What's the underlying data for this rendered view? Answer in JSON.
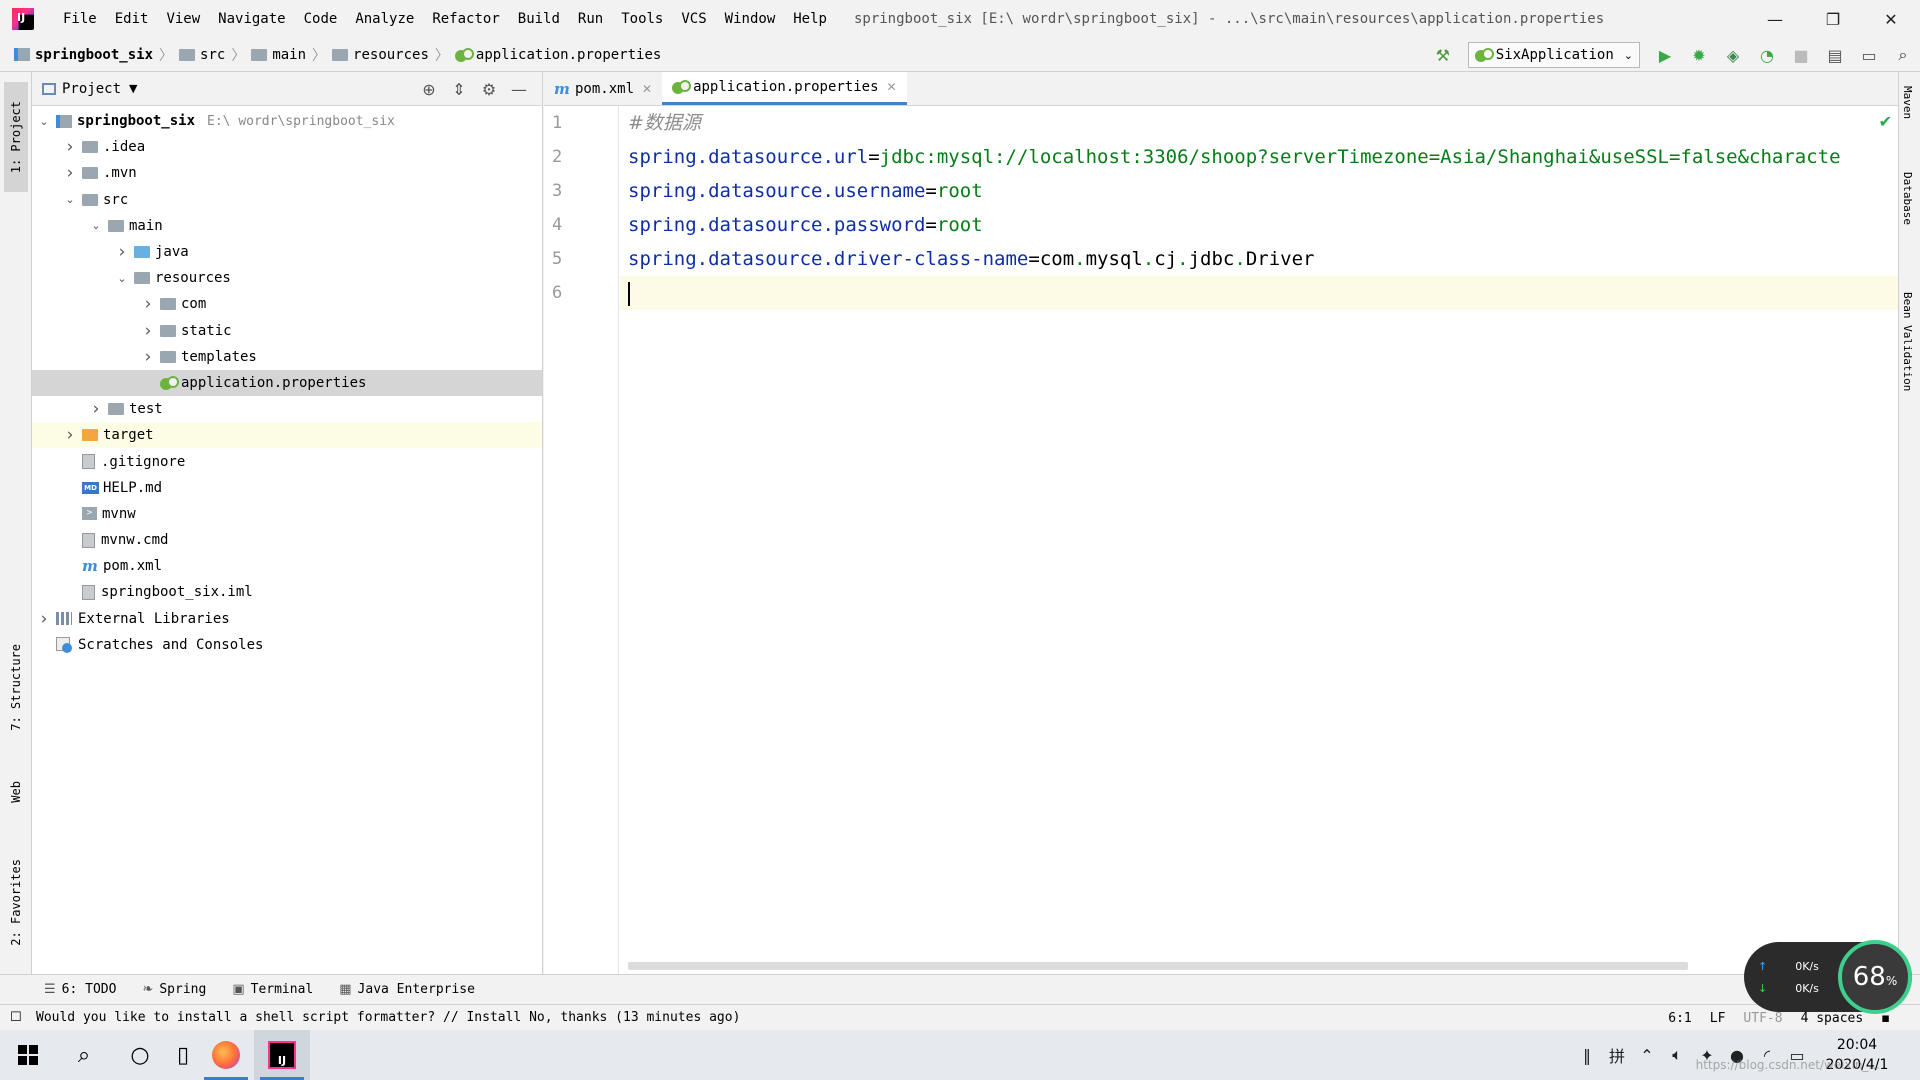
{
  "app": {
    "logo_letters": "IJ",
    "window_title": "springboot_six [E:\\ wordr\\springboot_six] - ...\\src\\main\\resources\\application.properties"
  },
  "menu": [
    "File",
    "Edit",
    "View",
    "Navigate",
    "Code",
    "Analyze",
    "Refactor",
    "Build",
    "Run",
    "Tools",
    "VCS",
    "Window",
    "Help"
  ],
  "window_controls": {
    "minimize": "—",
    "restore": "❐",
    "close": "✕"
  },
  "breadcrumb": [
    "springboot_six",
    "src",
    "main",
    "resources",
    "application.properties"
  ],
  "toolbar": {
    "run_config": "SixApplication",
    "icons": [
      "hammer-icon",
      "run-icon",
      "debug-icon",
      "coverage-icon",
      "profile-icon",
      "stop-icon",
      "project-structure-icon",
      "terminal-window-icon",
      "search-icon"
    ]
  },
  "left_strip": {
    "project": "1: Project",
    "structure": "7: Structure",
    "web": "Web",
    "favorites": "2: Favorites"
  },
  "right_strip": {
    "maven": "Maven",
    "database": "Database",
    "bean_validation": "Bean Validation"
  },
  "project_panel": {
    "title": "Project",
    "tree": [
      {
        "label": "springboot_six",
        "hint": "E:\\ wordr\\springboot_six",
        "indent": 0,
        "arrow": "down",
        "icon": "module",
        "bold": true
      },
      {
        "label": ".idea",
        "indent": 1,
        "arrow": "right",
        "icon": "folder"
      },
      {
        "label": ".mvn",
        "indent": 1,
        "arrow": "right",
        "icon": "folder"
      },
      {
        "label": "src",
        "indent": 1,
        "arrow": "down",
        "icon": "folder"
      },
      {
        "label": "main",
        "indent": 2,
        "arrow": "down",
        "icon": "folder"
      },
      {
        "label": "java",
        "indent": 3,
        "arrow": "right",
        "icon": "folder-blue"
      },
      {
        "label": "resources",
        "indent": 3,
        "arrow": "down",
        "icon": "folder-res"
      },
      {
        "label": "com",
        "indent": 4,
        "arrow": "right",
        "icon": "folder"
      },
      {
        "label": "static",
        "indent": 4,
        "arrow": "right",
        "icon": "folder"
      },
      {
        "label": "templates",
        "indent": 4,
        "arrow": "right",
        "icon": "folder"
      },
      {
        "label": "application.properties",
        "indent": 4,
        "arrow": "none",
        "icon": "properties",
        "selected": true
      },
      {
        "label": "test",
        "indent": 2,
        "arrow": "right",
        "icon": "folder"
      },
      {
        "label": "target",
        "indent": 1,
        "arrow": "right",
        "icon": "folder-orange",
        "excluded": true
      },
      {
        "label": ".gitignore",
        "indent": 1,
        "arrow": "none",
        "icon": "file"
      },
      {
        "label": "HELP.md",
        "indent": 1,
        "arrow": "none",
        "icon": "md"
      },
      {
        "label": "mvnw",
        "indent": 1,
        "arrow": "none",
        "icon": "exe"
      },
      {
        "label": "mvnw.cmd",
        "indent": 1,
        "arrow": "none",
        "icon": "file"
      },
      {
        "label": "pom.xml",
        "indent": 1,
        "arrow": "none",
        "icon": "maven"
      },
      {
        "label": "springboot_six.iml",
        "indent": 1,
        "arrow": "none",
        "icon": "file"
      },
      {
        "label": "External Libraries",
        "indent": 0,
        "arrow": "right",
        "icon": "libraries"
      },
      {
        "label": "Scratches and Consoles",
        "indent": 0,
        "arrow": "none",
        "icon": "scratches"
      }
    ]
  },
  "editor": {
    "tabs": [
      {
        "label": "pom.xml",
        "icon": "maven",
        "active": false
      },
      {
        "label": "application.properties",
        "icon": "properties",
        "active": true
      }
    ],
    "line_numbers": [
      "1",
      "2",
      "3",
      "4",
      "5",
      "6"
    ],
    "lines": [
      [
        {
          "t": "#数据源",
          "c": "comment"
        }
      ],
      [
        {
          "t": "spring.datasource.url",
          "c": "key"
        },
        {
          "t": "=",
          "c": "eq"
        },
        {
          "t": "jdbc:mysql://localhost:3306/shoop?serverTimezone=Asia/Shanghai&useSSL=false&characte",
          "c": "val"
        }
      ],
      [
        {
          "t": "spring.datasource.username",
          "c": "key"
        },
        {
          "t": "=",
          "c": "eq"
        },
        {
          "t": "root",
          "c": "val"
        }
      ],
      [
        {
          "t": "spring.datasource.password",
          "c": "key"
        },
        {
          "t": "=",
          "c": "eq"
        },
        {
          "t": "root",
          "c": "val"
        }
      ],
      [
        {
          "t": "spring.datasource.driver-class-name",
          "c": "key"
        },
        {
          "t": "=",
          "c": "eq"
        },
        {
          "t": "com",
          "c": "cls"
        },
        {
          "t": ".",
          "c": "dot"
        },
        {
          "t": "mysql",
          "c": "cls"
        },
        {
          "t": ".",
          "c": "dot"
        },
        {
          "t": "cj",
          "c": "cls"
        },
        {
          "t": ".",
          "c": "dot"
        },
        {
          "t": "jdbc",
          "c": "cls"
        },
        {
          "t": ".",
          "c": "dot"
        },
        {
          "t": "Driver",
          "c": "cls"
        }
      ],
      []
    ]
  },
  "bottom_tabs": [
    {
      "label": "6: TODO",
      "icon": "todo-icon",
      "glyph": "☰"
    },
    {
      "label": "Spring",
      "icon": "spring-icon",
      "glyph": "❧"
    },
    {
      "label": "Terminal",
      "icon": "terminal-icon",
      "glyph": "▣"
    },
    {
      "label": "Java Enterprise",
      "icon": "java-enterprise-icon",
      "glyph": "▦"
    }
  ],
  "status": {
    "message": "Would you like to install a shell script formatter? // Install    No, thanks (13 minutes ago)",
    "position": "6:1",
    "line_sep": "LF",
    "encoding": "UTF-8",
    "indent": "4 spaces"
  },
  "net_widget": {
    "up_rate": "0K/s",
    "down_rate": "0K/s",
    "percent": "68",
    "percent_unit": "%"
  },
  "taskbar": {
    "clock_time": "20:04",
    "clock_date": "2020/4/1",
    "ime": "拼",
    "watermark": "https://blog.csdn.net/weixin_..."
  }
}
